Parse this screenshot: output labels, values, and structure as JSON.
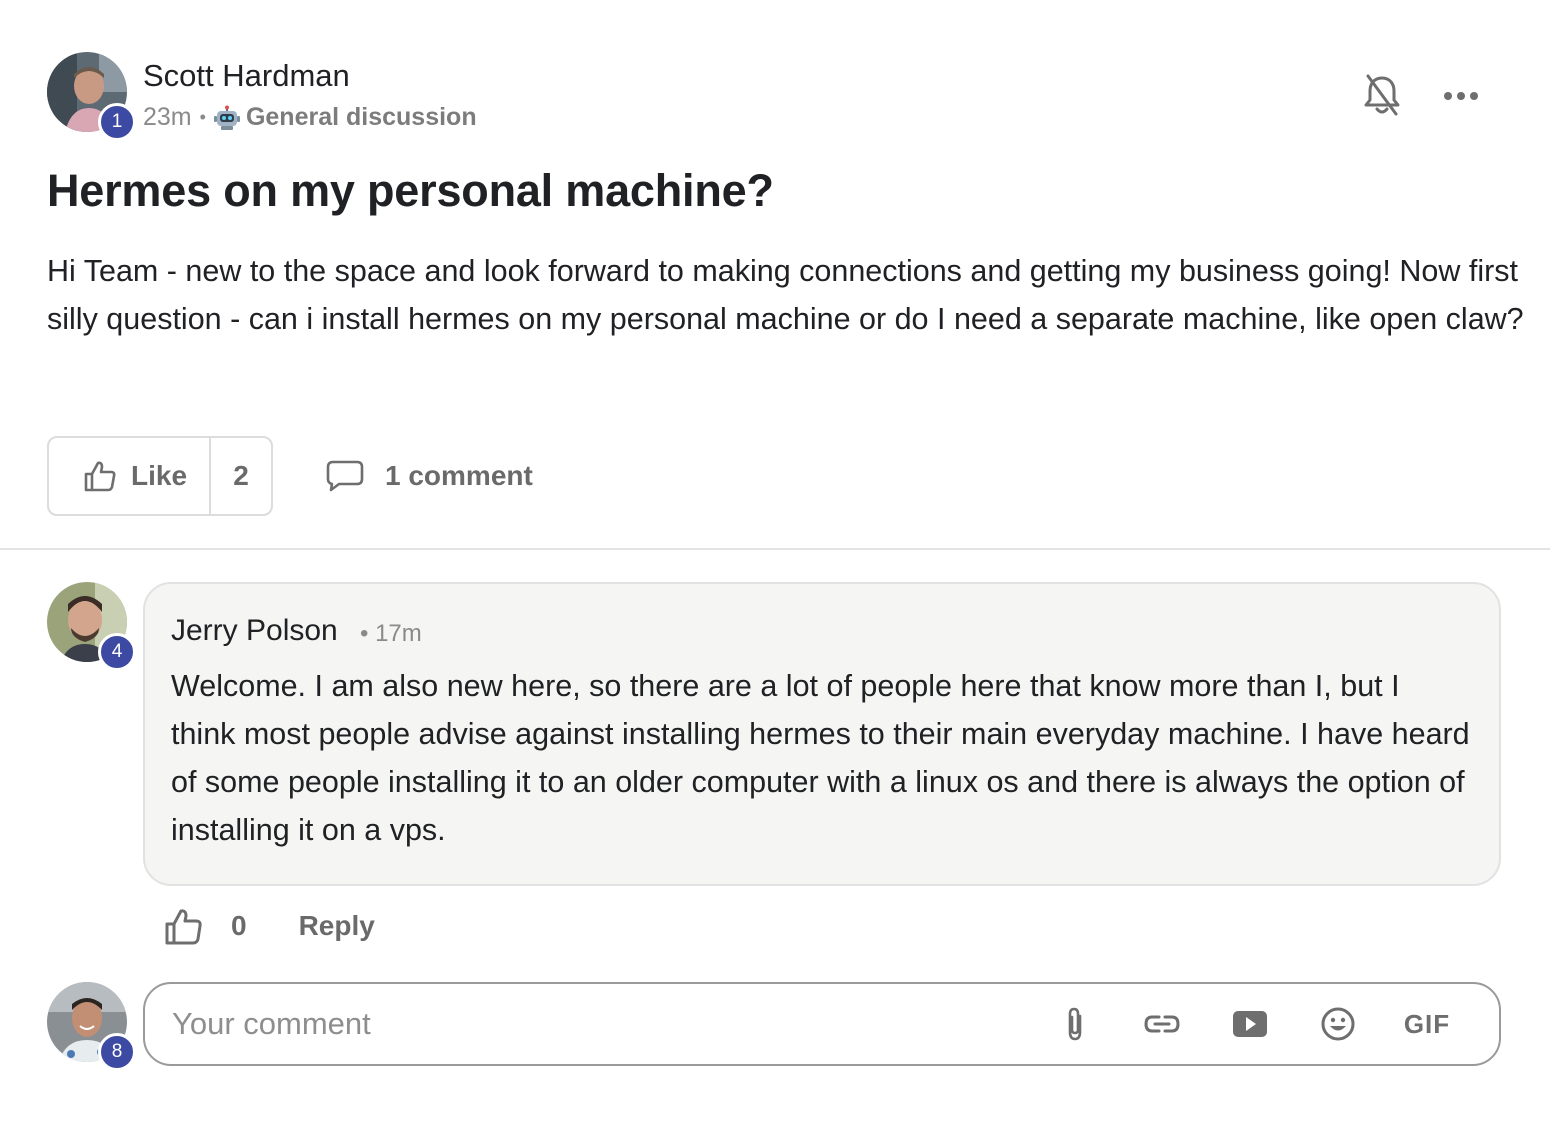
{
  "post": {
    "author": {
      "name": "Scott Hardman",
      "level": "1"
    },
    "time": "23m",
    "category": {
      "icon": "robot-icon",
      "name": "General discussion"
    },
    "title": "Hermes on my personal machine?",
    "body": "Hi Team - new to the space and look forward to making connections and getting my business going! Now first silly question - can i install hermes on my personal machine or do I need a separate machine, like open claw?",
    "header_icons": [
      "bell-off-icon",
      "more-icon"
    ],
    "like_label": "Like",
    "like_count": "2",
    "comment_count_label": "1 comment"
  },
  "comments": [
    {
      "author": "Jerry Polson",
      "level": "4",
      "time": "17m",
      "text": "Welcome. I am also new here, so there are a lot of people here that know more than I, but I think most people advise against installing hermes to their main everyday machine. I have heard of some people installing it to an older computer with a linux os and there is always the option of installing it on a vps.",
      "like_count": "0",
      "reply_label": "Reply"
    }
  ],
  "composer": {
    "user_level": "8",
    "placeholder": "Your comment",
    "tools": [
      "paperclip-icon",
      "link-icon",
      "video-icon",
      "emoji-icon"
    ],
    "gif_label": "GIF"
  },
  "colors": {
    "level_badge": "#3d4aa3",
    "muted_text": "#8a8a8a",
    "bubble_bg": "#f5f5f4"
  }
}
